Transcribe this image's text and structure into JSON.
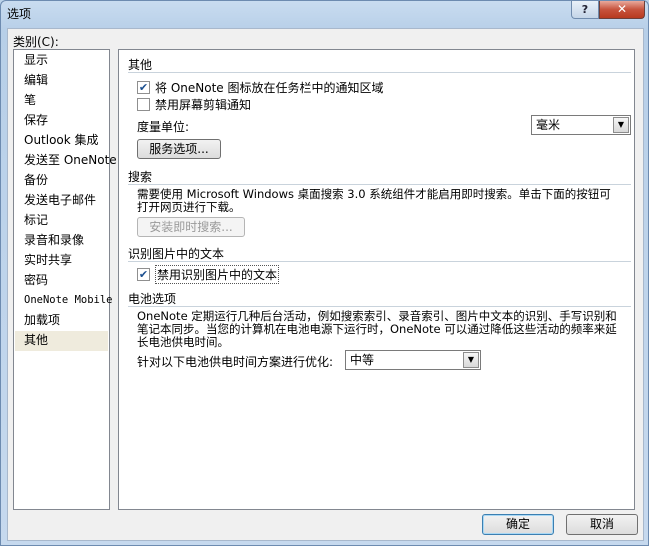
{
  "window": {
    "title": "选项",
    "help_label": "?",
    "close_label": "✕"
  },
  "categories": {
    "label": "类别(C):",
    "items": [
      {
        "label": "显示"
      },
      {
        "label": "编辑"
      },
      {
        "label": "笔"
      },
      {
        "label": "保存"
      },
      {
        "label": "Outlook 集成"
      },
      {
        "label": "发送至 OneNote"
      },
      {
        "label": "备份"
      },
      {
        "label": "发送电子邮件"
      },
      {
        "label": "标记"
      },
      {
        "label": "录音和录像"
      },
      {
        "label": "实时共享"
      },
      {
        "label": "密码"
      },
      {
        "label": "OneNote Mobile"
      },
      {
        "label": "加载项"
      },
      {
        "label": "其他",
        "selected": true
      }
    ]
  },
  "other": {
    "title": "其他",
    "tray_checkbox": {
      "label": "将 OneNote 图标放在任务栏中的通知区域",
      "checked": true
    },
    "clip_checkbox": {
      "label": "禁用屏幕剪辑通知",
      "checked": false
    },
    "unit_label": "度量单位:",
    "unit_value": "毫米",
    "service_button": "服务选项..."
  },
  "search": {
    "title": "搜索",
    "text_line1": "需要使用 Microsoft Windows 桌面搜索 3.0 系统组件才能启用即时搜索。单击下面的按钮可",
    "text_line2": "打开网页进行下载。",
    "install_button": "安装即时搜索..."
  },
  "ocr": {
    "title": "识别图片中的文本",
    "disable_checkbox": {
      "label": "禁用识别图片中的文本",
      "checked": true
    }
  },
  "battery": {
    "title": "电池选项",
    "text_line1": "OneNote 定期运行几种后台活动，例如搜索索引、录音索引、图片中文本的识别、手写识别和",
    "text_line2": "笔记本同步。当您的计算机在电池电源下运行时，OneNote 可以通过降低这些活动的频率来延",
    "text_line3": "长电池供电时间。",
    "optimize_label": "针对以下电池供电时间方案进行优化:",
    "optimize_value": "中等"
  },
  "footer": {
    "ok_button": "确定",
    "cancel_button": "取消"
  },
  "colors": {
    "accent": "#3c7fb1",
    "selected_bg": "#efebdd",
    "close_red": "#c7533d"
  }
}
